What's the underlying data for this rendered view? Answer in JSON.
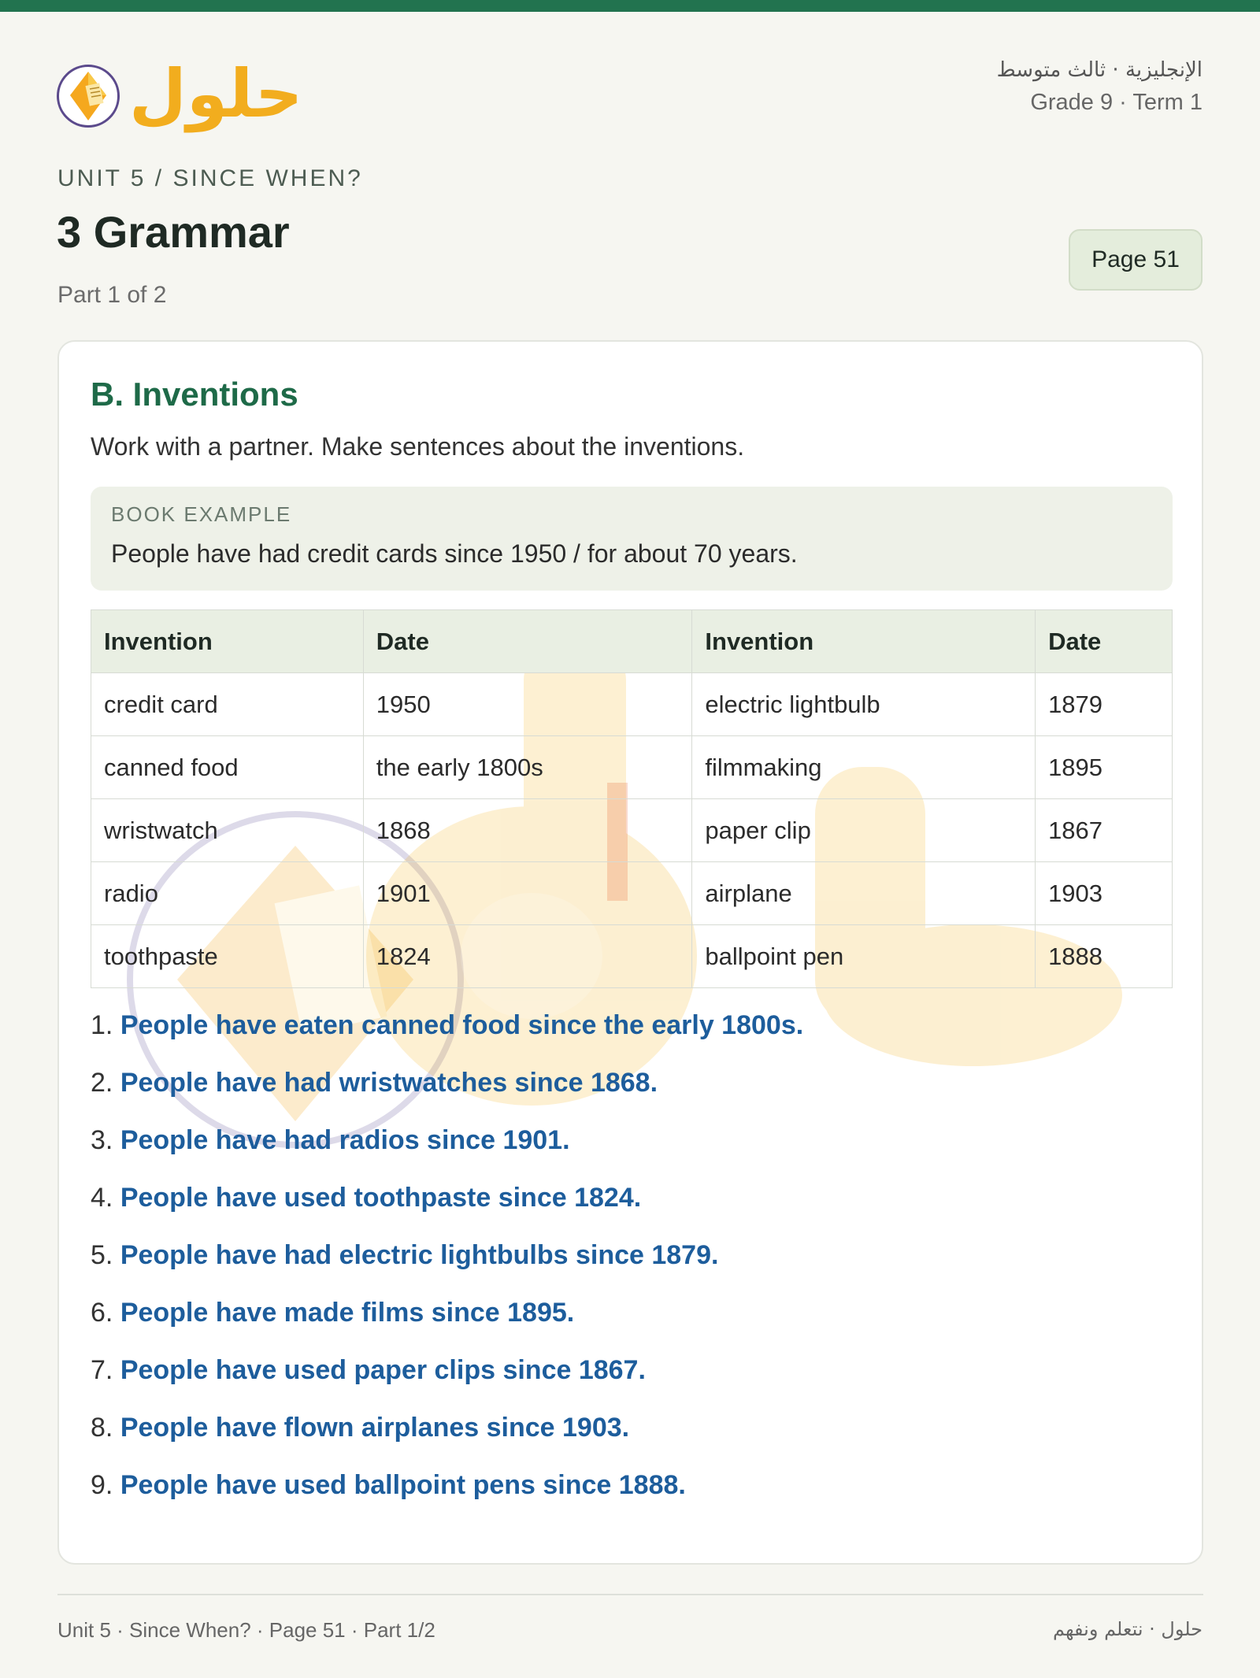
{
  "header": {
    "logo_text": "حلول",
    "subject_ar": "الإنجليزية · ثالث متوسط",
    "grade_term": "Grade 9 · Term 1"
  },
  "unit_line": "UNIT 5 / SINCE WHEN?",
  "title": "3 Grammar",
  "part": "Part 1 of 2",
  "page_badge": "Page 51",
  "section": {
    "title": "B. Inventions",
    "instruction": "Work with a partner. Make sentences about the inventions.",
    "example_label": "BOOK EXAMPLE",
    "example_text": "People have had credit cards since 1950 / for about 70 years."
  },
  "table": {
    "headers": [
      "Invention",
      "Date",
      "Invention",
      "Date"
    ],
    "rows": [
      [
        "credit card",
        "1950",
        "electric lightbulb",
        "1879"
      ],
      [
        "canned food",
        "the early 1800s",
        "filmmaking",
        "1895"
      ],
      [
        "wristwatch",
        "1868",
        "paper clip",
        "1867"
      ],
      [
        "radio",
        "1901",
        "airplane",
        "1903"
      ],
      [
        "toothpaste",
        "1824",
        "ballpoint pen",
        "1888"
      ]
    ]
  },
  "answers": [
    {
      "num": "1.",
      "text": "People have eaten canned food since the early 1800s."
    },
    {
      "num": "2.",
      "text": "People have had wristwatches since 1868."
    },
    {
      "num": "3.",
      "text": "People have had radios since 1901."
    },
    {
      "num": "4.",
      "text": "People have used toothpaste since 1824."
    },
    {
      "num": "5.",
      "text": "People have had electric lightbulbs since 1879."
    },
    {
      "num": "6.",
      "text": "People have made films since 1895."
    },
    {
      "num": "7.",
      "text": "People have used paper clips since 1867."
    },
    {
      "num": "8.",
      "text": "People have flown airplanes since 1903."
    },
    {
      "num": "9.",
      "text": "People have used ballpoint pens since 1888."
    }
  ],
  "footer": {
    "left": "Unit 5 · Since When? · Page 51 · Part 1/2",
    "right": "حلول · نتعلم ونفهم"
  },
  "colors": {
    "accent": "#22734f",
    "section_title": "#1e6a48",
    "answer": "#1d5d9c",
    "logo": "#f2ad1e"
  }
}
